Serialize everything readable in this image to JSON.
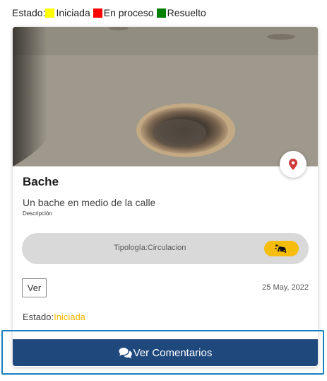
{
  "legend": {
    "label": "Estado:",
    "items": [
      {
        "label": "Iniciada",
        "color": "#ffff00"
      },
      {
        "label": "En proceso",
        "color": "#ff0000"
      },
      {
        "label": "Resuelto",
        "color": "#008000"
      }
    ]
  },
  "card": {
    "image_alt_icon": "pothole-photo",
    "title": "Bache",
    "description": "Un bache en medio de la calle",
    "description_label": "Descripción",
    "tipologia_label": "Tipología:",
    "tipologia_value": "Circulacion",
    "tipologia_icon": "car-crash-icon",
    "tipologia_badge_color": "#f6be0b",
    "ver_label": "Ver",
    "date": "25 May, 2022",
    "estado_label": "Estado:",
    "estado_value": "Iniciada",
    "estado_color": "#f0b400",
    "location_icon": "map-marker-icon",
    "location_icon_color": "#d03a3a"
  },
  "footer": {
    "comments_label": "Ver Comentarios",
    "comments_icon": "comments-icon",
    "button_color": "#1f497d",
    "focus_color": "#1a7fc1"
  }
}
